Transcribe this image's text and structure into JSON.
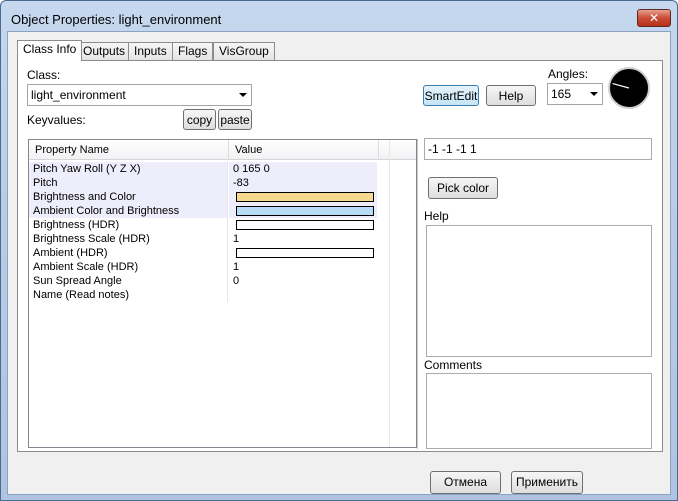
{
  "window": {
    "title": "Object Properties: light_environment",
    "close_glyph": "✕"
  },
  "tabs": [
    "Class Info",
    "Outputs",
    "Inputs",
    "Flags",
    "VisGroup"
  ],
  "class_info": {
    "class_label": "Class:",
    "class_value": "light_environment",
    "keyvalues_label": "Keyvalues:",
    "copy_label": "copy",
    "paste_label": "paste",
    "smartedit_label": "SmartEdit",
    "help_button_label": "Help",
    "angles_label": "Angles:",
    "angles_value": "165",
    "angle_degrees": 165,
    "grid": {
      "headers": [
        "Property Name",
        "Value"
      ],
      "rows": [
        {
          "name": "Pitch Yaw Roll (Y Z X)",
          "value": "0 165 0",
          "selected": true
        },
        {
          "name": "Pitch",
          "value": "-83",
          "selected": true
        },
        {
          "name": "Brightness and Color",
          "value": "",
          "swatch": "#f6d98f",
          "selected": true
        },
        {
          "name": "Ambient Color and Brightness",
          "value": "",
          "swatch": "#b7dcf5",
          "selected": true
        },
        {
          "name": "Brightness (HDR)",
          "value": "",
          "swatch": "#ffffff",
          "selected": false
        },
        {
          "name": "Brightness Scale (HDR)",
          "value": "1",
          "selected": false
        },
        {
          "name": "Ambient (HDR)",
          "value": "",
          "swatch": "#ffffff",
          "selected": false
        },
        {
          "name": "Ambient Scale (HDR)",
          "value": "1",
          "selected": false
        },
        {
          "name": "Sun Spread Angle",
          "value": "0",
          "selected": false
        },
        {
          "name": "Name (Read notes)",
          "value": "",
          "selected": false
        }
      ]
    },
    "value_field": "-1 -1 -1 1",
    "pick_color_label": "Pick color",
    "help_label": "Help",
    "comments_label": "Comments"
  },
  "footer": {
    "cancel_label": "Отмена",
    "apply_label": "Применить"
  }
}
